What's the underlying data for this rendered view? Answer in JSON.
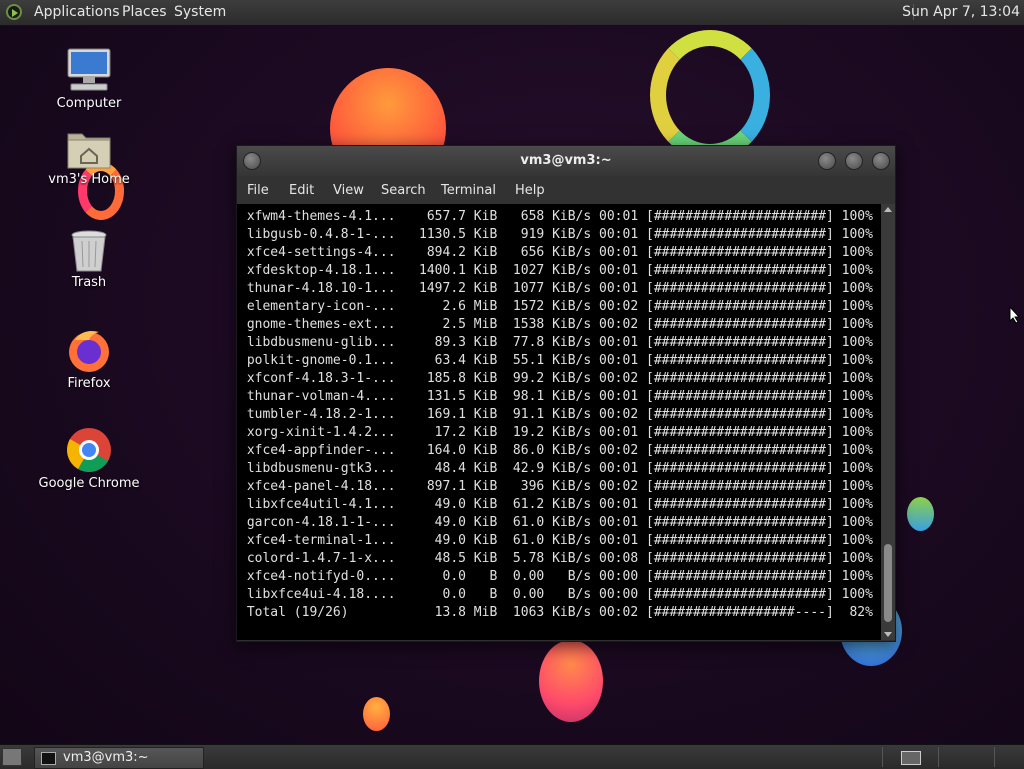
{
  "top_panel": {
    "menus": [
      "Applications",
      "Places",
      "System"
    ],
    "clock": "Sun Apr  7, 13:04"
  },
  "desktop_icons": [
    {
      "label": "Computer",
      "icon": "computer-icon"
    },
    {
      "label": "vm3's Home",
      "icon": "home-folder-icon"
    },
    {
      "label": "Trash",
      "icon": "trash-icon"
    },
    {
      "label": "Firefox",
      "icon": "firefox-icon"
    },
    {
      "label": "Google Chrome",
      "icon": "chrome-icon"
    }
  ],
  "window": {
    "title": "vm3@vm3:~",
    "menu": [
      "File",
      "Edit",
      "View",
      "Search",
      "Terminal",
      "Help"
    ],
    "lines": [
      " xfwm4-themes-4.1...    657.7 KiB   658 KiB/s 00:01 [######################] 100%",
      " libgusb-0.4.8-1-...   1130.5 KiB   919 KiB/s 00:01 [######################] 100%",
      " xfce4-settings-4...    894.2 KiB   656 KiB/s 00:01 [######################] 100%",
      " xfdesktop-4.18.1...   1400.1 KiB  1027 KiB/s 00:01 [######################] 100%",
      " thunar-4.18.10-1...   1497.2 KiB  1077 KiB/s 00:01 [######################] 100%",
      " elementary-icon-...      2.6 MiB  1572 KiB/s 00:02 [######################] 100%",
      " gnome-themes-ext...      2.5 MiB  1538 KiB/s 00:02 [######################] 100%",
      " libdbusmenu-glib...     89.3 KiB  77.8 KiB/s 00:01 [######################] 100%",
      " polkit-gnome-0.1...     63.4 KiB  55.1 KiB/s 00:01 [######################] 100%",
      " xfconf-4.18.3-1-...    185.8 KiB  99.2 KiB/s 00:02 [######################] 100%",
      " thunar-volman-4....    131.5 KiB  98.1 KiB/s 00:01 [######################] 100%",
      " tumbler-4.18.2-1...    169.1 KiB  91.1 KiB/s 00:02 [######################] 100%",
      " xorg-xinit-1.4.2...     17.2 KiB  19.2 KiB/s 00:01 [######################] 100%",
      " xfce4-appfinder-...    164.0 KiB  86.0 KiB/s 00:02 [######################] 100%",
      " libdbusmenu-gtk3...     48.4 KiB  42.9 KiB/s 00:01 [######################] 100%",
      " xfce4-panel-4.18...    897.1 KiB   396 KiB/s 00:02 [######################] 100%",
      " libxfce4util-4.1...     49.0 KiB  61.2 KiB/s 00:01 [######################] 100%",
      " garcon-4.18.1-1-...     49.0 KiB  61.0 KiB/s 00:01 [######################] 100%",
      " xfce4-terminal-1...     49.0 KiB  61.0 KiB/s 00:01 [######################] 100%",
      " colord-1.4.7-1-x...     48.5 KiB  5.78 KiB/s 00:08 [######################] 100%",
      " xfce4-notifyd-0....      0.0   B  0.00   B/s 00:00 [######################] 100%",
      " libxfce4ui-4.18....      0.0   B  0.00   B/s 00:00 [######################] 100%",
      " Total (19/26)           13.8 MiB  1063 KiB/s 00:02 [##################----]  82%"
    ]
  },
  "taskbar": {
    "task_label": "vm3@vm3:~"
  }
}
